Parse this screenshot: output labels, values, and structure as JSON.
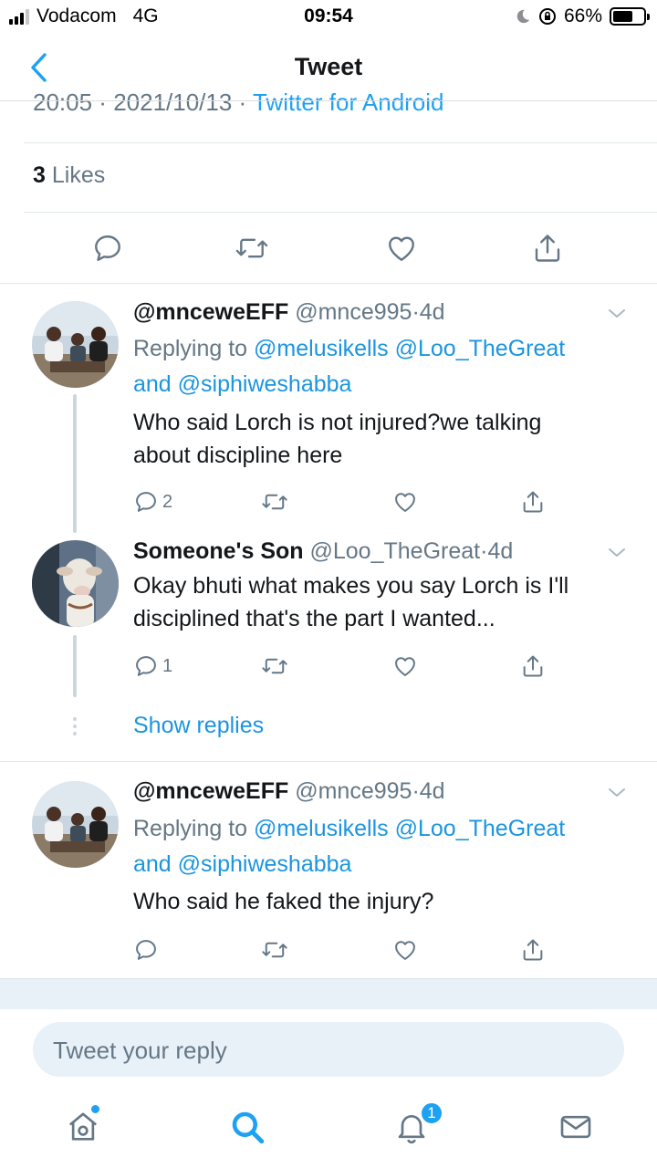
{
  "status_bar": {
    "carrier": "Vodacom",
    "network": "4G",
    "time": "09:54",
    "battery": "66%",
    "battery_level": 0.66
  },
  "nav": {
    "title": "Tweet"
  },
  "tweet_meta": {
    "time": "20:05",
    "date": "2021/10/13",
    "source": "Twitter for Android"
  },
  "likes": {
    "count": "3",
    "label": "Likes"
  },
  "replies": [
    {
      "name": "@mnceweEFF",
      "handle": "@mnce995",
      "age": "4d",
      "replying_prefix": "Replying to",
      "replying_user1": "@melusikells",
      "replying_user2": "@Loo_TheGreat",
      "replying_and": "and",
      "replying_user3": "@siphiweshabba",
      "text_line1": "Who said Lorch is not injured?we talking",
      "text_line2": "about discipline here",
      "reply_count": "2"
    },
    {
      "name": "Someone's Son",
      "handle": "@Loo_TheGreat",
      "age": "4d",
      "text_line1": "Okay bhuti what makes you say Lorch is I'll",
      "text_line2": "disciplined that's the part I wanted...",
      "reply_count": "1"
    },
    {
      "name": "@mnceweEFF",
      "handle": "@mnce995",
      "age": "4d",
      "replying_prefix": "Replying to",
      "replying_user1": "@melusikells",
      "replying_user2": "@Loo_TheGreat",
      "replying_and": "and",
      "replying_user3": "@siphiweshabba",
      "text_line1": "Who said he faked the injury?",
      "reply_count": ""
    }
  ],
  "show_replies": "Show replies",
  "composer": {
    "placeholder": "Tweet your reply"
  },
  "tab_bar": {
    "notifications_badge": "1"
  },
  "colors": {
    "accent": "#1da1f2",
    "link": "#1b95e0",
    "muted": "#657786"
  }
}
